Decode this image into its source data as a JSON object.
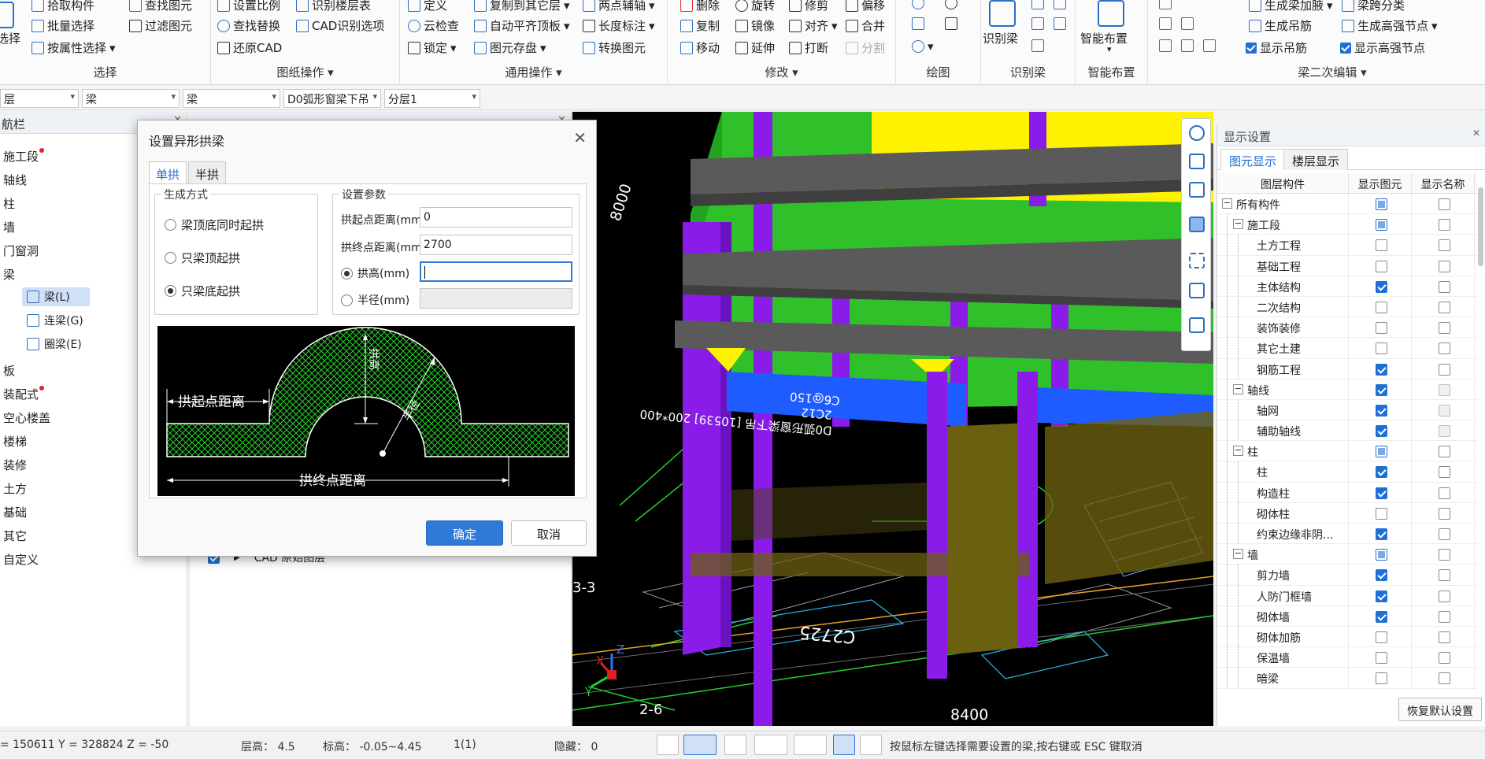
{
  "ribbon": {
    "select": {
      "title": "选择",
      "big_label": "选择",
      "items": [
        "拾取构件",
        "批量选择",
        "按属性选择",
        "查找图元",
        "过滤图元"
      ]
    },
    "drawing_ops": {
      "title": "图纸操作",
      "items": [
        "设置比例",
        "查找替换",
        "还原CAD",
        "识别楼层表",
        "CAD识别选项"
      ]
    },
    "general_ops": {
      "title": "通用操作",
      "items": [
        "定义",
        "云检查",
        "锁定",
        "复制到其它层",
        "自动平齐顶板",
        "图元存盘",
        "两点辅轴",
        "长度标注",
        "转换图元"
      ]
    },
    "modify": {
      "title": "修改",
      "items": [
        "删除",
        "复制",
        "移动",
        "旋转",
        "镜像",
        "延伸",
        "修剪",
        "对齐",
        "打断",
        "偏移",
        "合并",
        "分割"
      ]
    },
    "draw": {
      "title": "绘图"
    },
    "recognize_beam": {
      "title": "识别梁",
      "big_label": "识别梁"
    },
    "smart_layout": {
      "title": "智能布置",
      "big_label": "智能布置"
    },
    "beam_edit": {
      "title": "梁二次编辑",
      "items": [
        "生成梁加腋",
        "生成吊筋",
        "显示吊筋",
        "梁跨分类",
        "生成高强节点",
        "显示高强节点"
      ]
    }
  },
  "toolbar2": {
    "combos": [
      "层",
      "梁",
      "梁",
      "D0弧形窗梁下吊",
      "分层1"
    ]
  },
  "leftnav": {
    "title": "航栏",
    "items": [
      {
        "label": "施工段",
        "dot": true
      },
      {
        "label": "轴线",
        "dot": false
      },
      {
        "label": "柱",
        "dot": false
      },
      {
        "label": "墙",
        "dot": false
      },
      {
        "label": "门窗洞",
        "dot": false
      },
      {
        "label": "梁",
        "dot": false
      }
    ],
    "subitems": [
      {
        "label": "梁(L)",
        "selected": true
      },
      {
        "label": "连梁(G)",
        "selected": false
      },
      {
        "label": "圈梁(E)",
        "selected": false
      }
    ],
    "items2": [
      {
        "label": "板",
        "dot": false
      },
      {
        "label": "装配式",
        "dot": true
      },
      {
        "label": "空心楼盖",
        "dot": false
      },
      {
        "label": "楼梯",
        "dot": false
      },
      {
        "label": "装修",
        "dot": false
      },
      {
        "label": "土方",
        "dot": false
      },
      {
        "label": "基础",
        "dot": false
      },
      {
        "label": "其它",
        "dot": false
      },
      {
        "label": "自定义",
        "dot": false
      }
    ]
  },
  "midpanel": {
    "row_label": "CAD 原始图层"
  },
  "viewport": {
    "dim_8000": "8000",
    "dim_8400": "8400",
    "axis_26": "2-6",
    "axis_33": "3-3",
    "beam_text": "D0弧形窗梁下吊 [10539] 200*400",
    "rebar_text": "2C12",
    "stirrup_text": "C6@150",
    "c2725": "C2725",
    "axis_x": "X",
    "axis_y": "Y",
    "axis_z": "Z"
  },
  "dialog": {
    "title": "设置异形拱梁",
    "tabs": [
      {
        "label": "单拱",
        "active": true
      },
      {
        "label": "半拱",
        "active": false
      }
    ],
    "gen_mode": {
      "legend": "生成方式",
      "options": [
        {
          "label": "梁顶底同时起拱",
          "checked": false
        },
        {
          "label": "只梁顶起拱",
          "checked": false
        },
        {
          "label": "只梁底起拱",
          "checked": true
        }
      ]
    },
    "params": {
      "legend": "设置参数",
      "start_label": "拱起点距离(mm)",
      "start_value": "0",
      "end_label": "拱终点距离(mm)",
      "end_value": "2700",
      "height_label": "拱高(mm)",
      "height_value": "",
      "height_checked": true,
      "radius_label": "半径(mm)",
      "radius_value": "",
      "radius_checked": false
    },
    "diagram": {
      "start_text": "拱起点距离",
      "end_text": "拱终点距离",
      "height_text": "拱高",
      "radius_text": "半径"
    },
    "ok_label": "确定",
    "cancel_label": "取消"
  },
  "rightpanel": {
    "title": "显示设置",
    "tabs": [
      {
        "label": "图元显示",
        "active": true
      },
      {
        "label": "楼层显示",
        "active": false
      }
    ],
    "columns": [
      "图层构件",
      "显示图元",
      "显示名称"
    ],
    "rows": [
      {
        "label": "所有构件",
        "level": 0,
        "expander": "−",
        "show": "part",
        "name": "off"
      },
      {
        "label": "施工段",
        "level": 1,
        "expander": "−",
        "show": "part",
        "name": "off"
      },
      {
        "label": "土方工程",
        "level": 2,
        "expander": "",
        "show": "off",
        "name": "off"
      },
      {
        "label": "基础工程",
        "level": 2,
        "expander": "",
        "show": "off",
        "name": "off"
      },
      {
        "label": "主体结构",
        "level": 2,
        "expander": "",
        "show": "on",
        "name": "off"
      },
      {
        "label": "二次结构",
        "level": 2,
        "expander": "",
        "show": "off",
        "name": "off"
      },
      {
        "label": "装饰装修",
        "level": 2,
        "expander": "",
        "show": "off",
        "name": "off"
      },
      {
        "label": "其它土建",
        "level": 2,
        "expander": "",
        "show": "off",
        "name": "off"
      },
      {
        "label": "钢筋工程",
        "level": 2,
        "expander": "",
        "show": "on",
        "name": "off"
      },
      {
        "label": "轴线",
        "level": 1,
        "expander": "−",
        "show": "on",
        "name": "dis"
      },
      {
        "label": "轴网",
        "level": 2,
        "expander": "",
        "show": "on",
        "name": "dis"
      },
      {
        "label": "辅助轴线",
        "level": 2,
        "expander": "",
        "show": "on",
        "name": "dis"
      },
      {
        "label": "柱",
        "level": 1,
        "expander": "−",
        "show": "part",
        "name": "off"
      },
      {
        "label": "柱",
        "level": 2,
        "expander": "",
        "show": "on",
        "name": "off"
      },
      {
        "label": "构造柱",
        "level": 2,
        "expander": "",
        "show": "on",
        "name": "off"
      },
      {
        "label": "砌体柱",
        "level": 2,
        "expander": "",
        "show": "off",
        "name": "off"
      },
      {
        "label": "约束边缘非阴...",
        "level": 2,
        "expander": "",
        "show": "on",
        "name": "off"
      },
      {
        "label": "墙",
        "level": 1,
        "expander": "−",
        "show": "part",
        "name": "off"
      },
      {
        "label": "剪力墙",
        "level": 2,
        "expander": "",
        "show": "on",
        "name": "off"
      },
      {
        "label": "人防门框墙",
        "level": 2,
        "expander": "",
        "show": "on",
        "name": "off"
      },
      {
        "label": "砌体墙",
        "level": 2,
        "expander": "",
        "show": "on",
        "name": "off"
      },
      {
        "label": "砌体加筋",
        "level": 2,
        "expander": "",
        "show": "off",
        "name": "off"
      },
      {
        "label": "保温墙",
        "level": 2,
        "expander": "",
        "show": "off",
        "name": "off"
      },
      {
        "label": "暗梁",
        "level": 2,
        "expander": "",
        "show": "off",
        "name": "off"
      }
    ],
    "restore_label": "恢复默认设置"
  },
  "statusbar": {
    "coords": "= 150611 Y = 328824 Z = -50",
    "floor_height": "层高：  4.5",
    "elevation": "标高：  -0.05~4.45",
    "count": "1(1)",
    "hidden": "隐藏：  0",
    "hint": "按鼠标左键选择需要设置的梁,按右键或 ESC 键取消"
  },
  "colors": {
    "accent": "#2f7ad8",
    "green": "#2fc02a",
    "purple": "#8a1be8",
    "yellow": "#fff200",
    "blue": "#1f5cff",
    "olive": "#6b6010",
    "gray": "#5a5a5a"
  }
}
